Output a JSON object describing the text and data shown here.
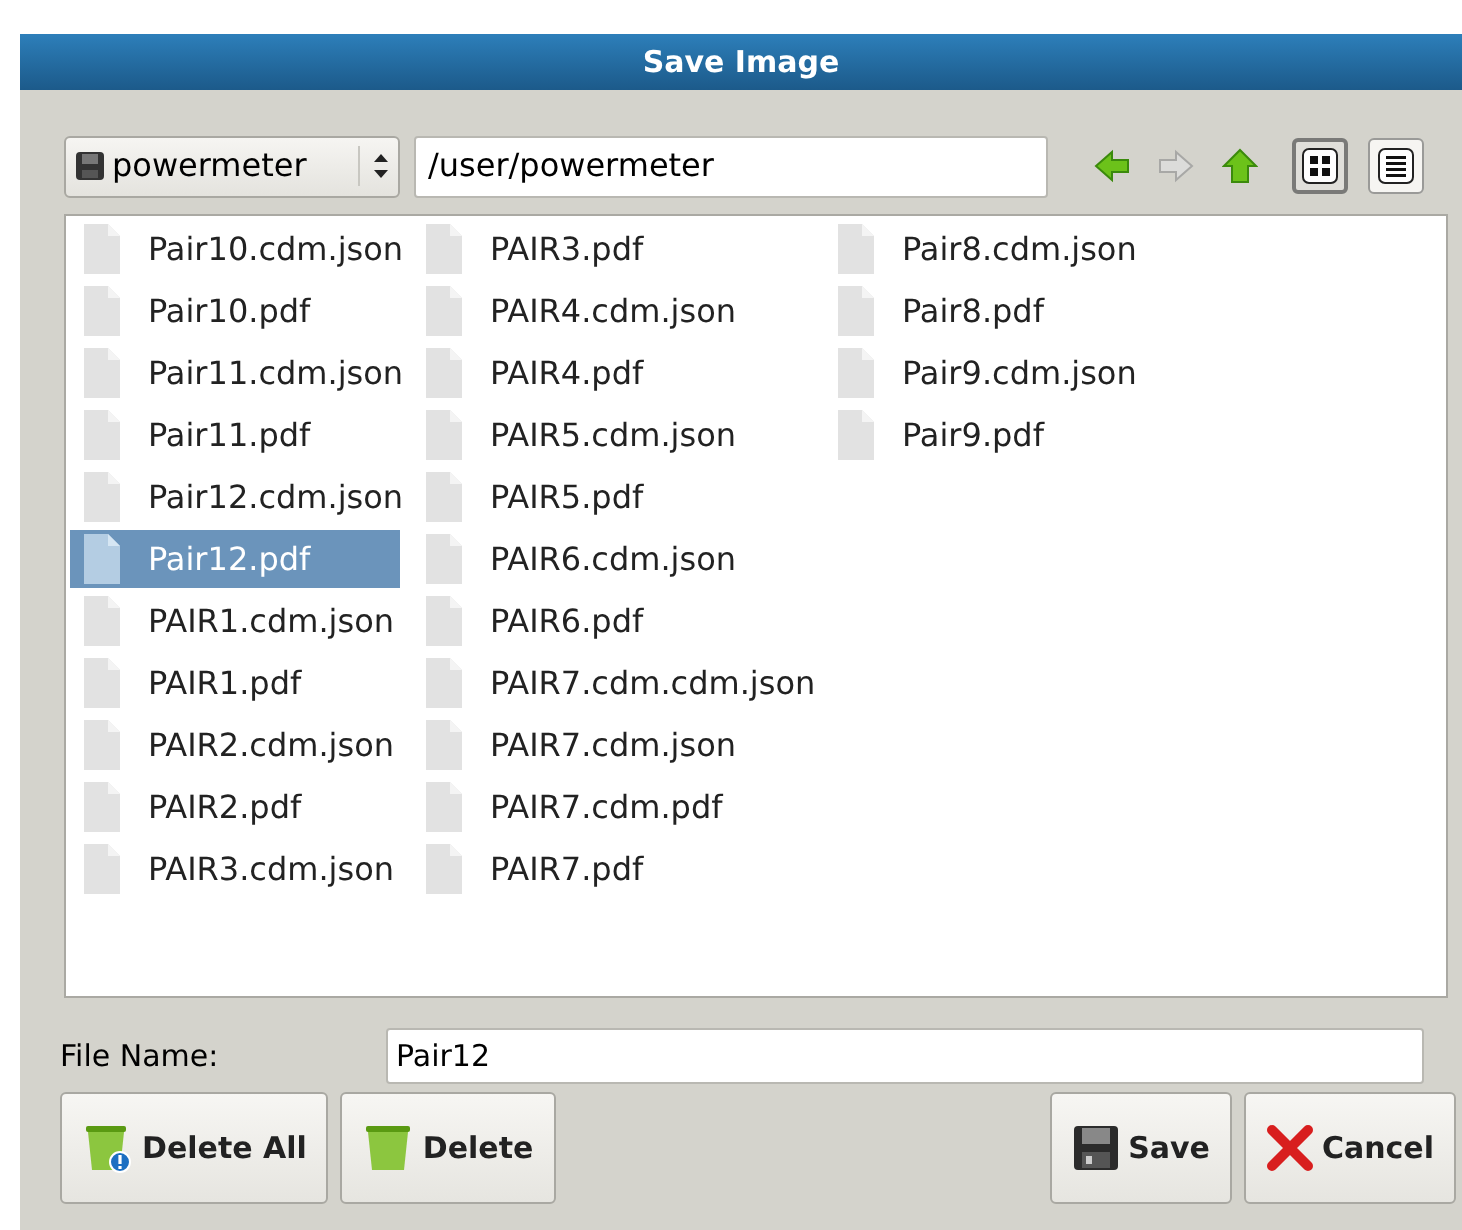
{
  "window": {
    "title": "Save Image"
  },
  "toolbar": {
    "location": "powermeter",
    "path": "/user/powermeter",
    "nav": [
      {
        "kind": "back",
        "disabled": false
      },
      {
        "kind": "forward",
        "disabled": true
      },
      {
        "kind": "up",
        "disabled": false
      }
    ],
    "views": [
      {
        "kind": "icons",
        "selected": true
      },
      {
        "kind": "list",
        "selected": false
      }
    ]
  },
  "files": [
    {
      "name": "Pair10.cdm.json",
      "selected": false
    },
    {
      "name": "Pair10.pdf",
      "selected": false
    },
    {
      "name": "Pair11.cdm.json",
      "selected": false
    },
    {
      "name": "Pair11.pdf",
      "selected": false
    },
    {
      "name": "Pair12.cdm.json",
      "selected": false
    },
    {
      "name": "Pair12.pdf",
      "selected": true
    },
    {
      "name": "PAIR1.cdm.json",
      "selected": false
    },
    {
      "name": "PAIR1.pdf",
      "selected": false
    },
    {
      "name": "PAIR2.cdm.json",
      "selected": false
    },
    {
      "name": "PAIR2.pdf",
      "selected": false
    },
    {
      "name": "PAIR3.cdm.json",
      "selected": false
    },
    {
      "name": "PAIR3.pdf",
      "selected": false
    },
    {
      "name": "PAIR4.cdm.json",
      "selected": false
    },
    {
      "name": "PAIR4.pdf",
      "selected": false
    },
    {
      "name": "PAIR5.cdm.json",
      "selected": false
    },
    {
      "name": "PAIR5.pdf",
      "selected": false
    },
    {
      "name": "PAIR6.cdm.json",
      "selected": false
    },
    {
      "name": "PAIR6.pdf",
      "selected": false
    },
    {
      "name": "PAIR7.cdm.cdm.json",
      "selected": false
    },
    {
      "name": "PAIR7.cdm.json",
      "selected": false
    },
    {
      "name": "PAIR7.cdm.pdf",
      "selected": false
    },
    {
      "name": "PAIR7.pdf",
      "selected": false
    },
    {
      "name": "Pair8.cdm.json",
      "selected": false
    },
    {
      "name": "Pair8.pdf",
      "selected": false
    },
    {
      "name": "Pair9.cdm.json",
      "selected": false
    },
    {
      "name": "Pair9.pdf",
      "selected": false
    }
  ],
  "file_name": {
    "label": "File Name:",
    "value": "Pair12"
  },
  "buttons_left": [
    {
      "kind": "delete_all",
      "label": "Delete All"
    },
    {
      "kind": "delete",
      "label": "Delete"
    }
  ],
  "buttons_right": [
    {
      "kind": "save",
      "label": "Save"
    },
    {
      "kind": "cancel",
      "label": "Cancel"
    }
  ]
}
